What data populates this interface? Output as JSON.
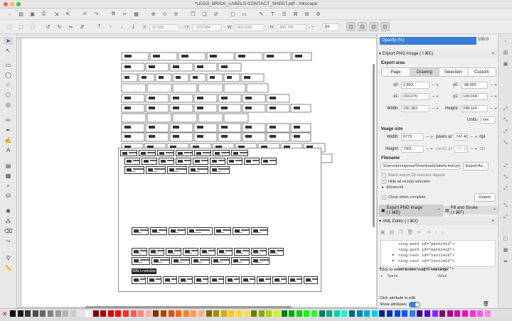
{
  "window": {
    "title": "*LEGO_BRICK_LABELS-CONTACT_SHEET.pdf - Inkscape"
  },
  "toolbar": {
    "x_label": "X:",
    "x_value": "10.933",
    "y_label": "Y:",
    "y_value": "-373.984",
    "w_label": "W:",
    "w_value": "831.933",
    "h_label": "H:",
    "h_value": "465.705",
    "unit": "px"
  },
  "canvas": {
    "badge": "WALL+window"
  },
  "panel": {
    "opacity_label": "Opacity (%)",
    "opacity_value": "100.0",
    "export_tab": "Export PNG Image (⇧⌘E)",
    "export_area": "Export area",
    "area_tabs": [
      "Page",
      "Drawing",
      "Selection",
      "Custom"
    ],
    "x0_label": "x0:",
    "x0": "2.893",
    "y0_label": "y0:",
    "y0": "-98.950",
    "x1_label": "x1:",
    "x1": "233.276",
    "y1_label": "y1:",
    "y1": "149.164",
    "width_label": "Width:",
    "width": "230.383",
    "height_label": "Height:",
    "height": "248.114",
    "units_label": "Units:",
    "units": "mm",
    "image_size": "Image size",
    "img_width_label": "Width:",
    "img_width": "6779",
    "pixels_at": "pixels at",
    "dpi_value": "747.40",
    "dpi": "dpi",
    "img_height_label": "Height:",
    "img_height": "7301",
    "pixels_at2": "pixels at",
    "dpi_value2": "747.40",
    "dpi2": "dpi",
    "filename_label": "Filename",
    "filename": "/Users/amotsjonov/Downloads/labels-test.png",
    "export_as": "Export As...",
    "batch": "Batch export 26 selected objects",
    "hide": "Hide all except selected",
    "advanced": "Advanced",
    "close_when": "Close when complete",
    "export_btn": "Export",
    "dock_tab1": "Export PNG Image (⇧⌘E)",
    "dock_tab2": "Fill and Stroke (⇧⌘F)",
    "xml_tab": "XML Editor (⇧⌘X)",
    "xml_nodes": [
      "<svg:path id=\"path2413\">",
      "<svg:path id=\"path2415\">",
      "<svg:text id=\"text2419\">",
      "<svg:text id=\"text2423\">",
      "<svg:text id=\"text2427\">"
    ],
    "xml_hint": "Click to select nodes, drag to rearrange.",
    "attr_name": "Name",
    "attr_value": "Value",
    "attr_hint": "Click attribute to edit.",
    "show_attrs": "Show attributes"
  },
  "palette": {
    "colors": [
      "#000000",
      "#1a1a1a",
      "#333333",
      "#4d4d4d",
      "#666666",
      "#808080",
      "#999999",
      "#b3b3b3",
      "#cccccc",
      "#e6e6e6",
      "#ffffff",
      "#800000",
      "#aa0000",
      "#d40000",
      "#ff0000",
      "#ff2a2a",
      "#ff5555",
      "#ff8080",
      "#ffaaaa",
      "#803300",
      "#aa4400",
      "#d45500",
      "#ff6600",
      "#ff7f2a",
      "#ff9955",
      "#ffb380",
      "#806600",
      "#aa8800",
      "#d4aa00",
      "#ffcc00",
      "#ffd42a",
      "#ffdd55",
      "#668000",
      "#88aa00",
      "#aad400",
      "#ccff00",
      "#008000",
      "#00aa00",
      "#00d400",
      "#00ff00",
      "#2aff2a",
      "#00806a",
      "#00aa88",
      "#00d4aa",
      "#00ffcc",
      "#006680",
      "#0088aa",
      "#00aad4",
      "#00ccff",
      "#002280",
      "#0033aa",
      "#0044d4",
      "#0055ff",
      "#2a7fff",
      "#440080",
      "#5500d4",
      "#7f2aff",
      "#800066",
      "#aa0088",
      "#d400aa",
      "#ff00cc",
      "#ff2ad4",
      "#ff55dd",
      "#ff80e5"
    ]
  }
}
